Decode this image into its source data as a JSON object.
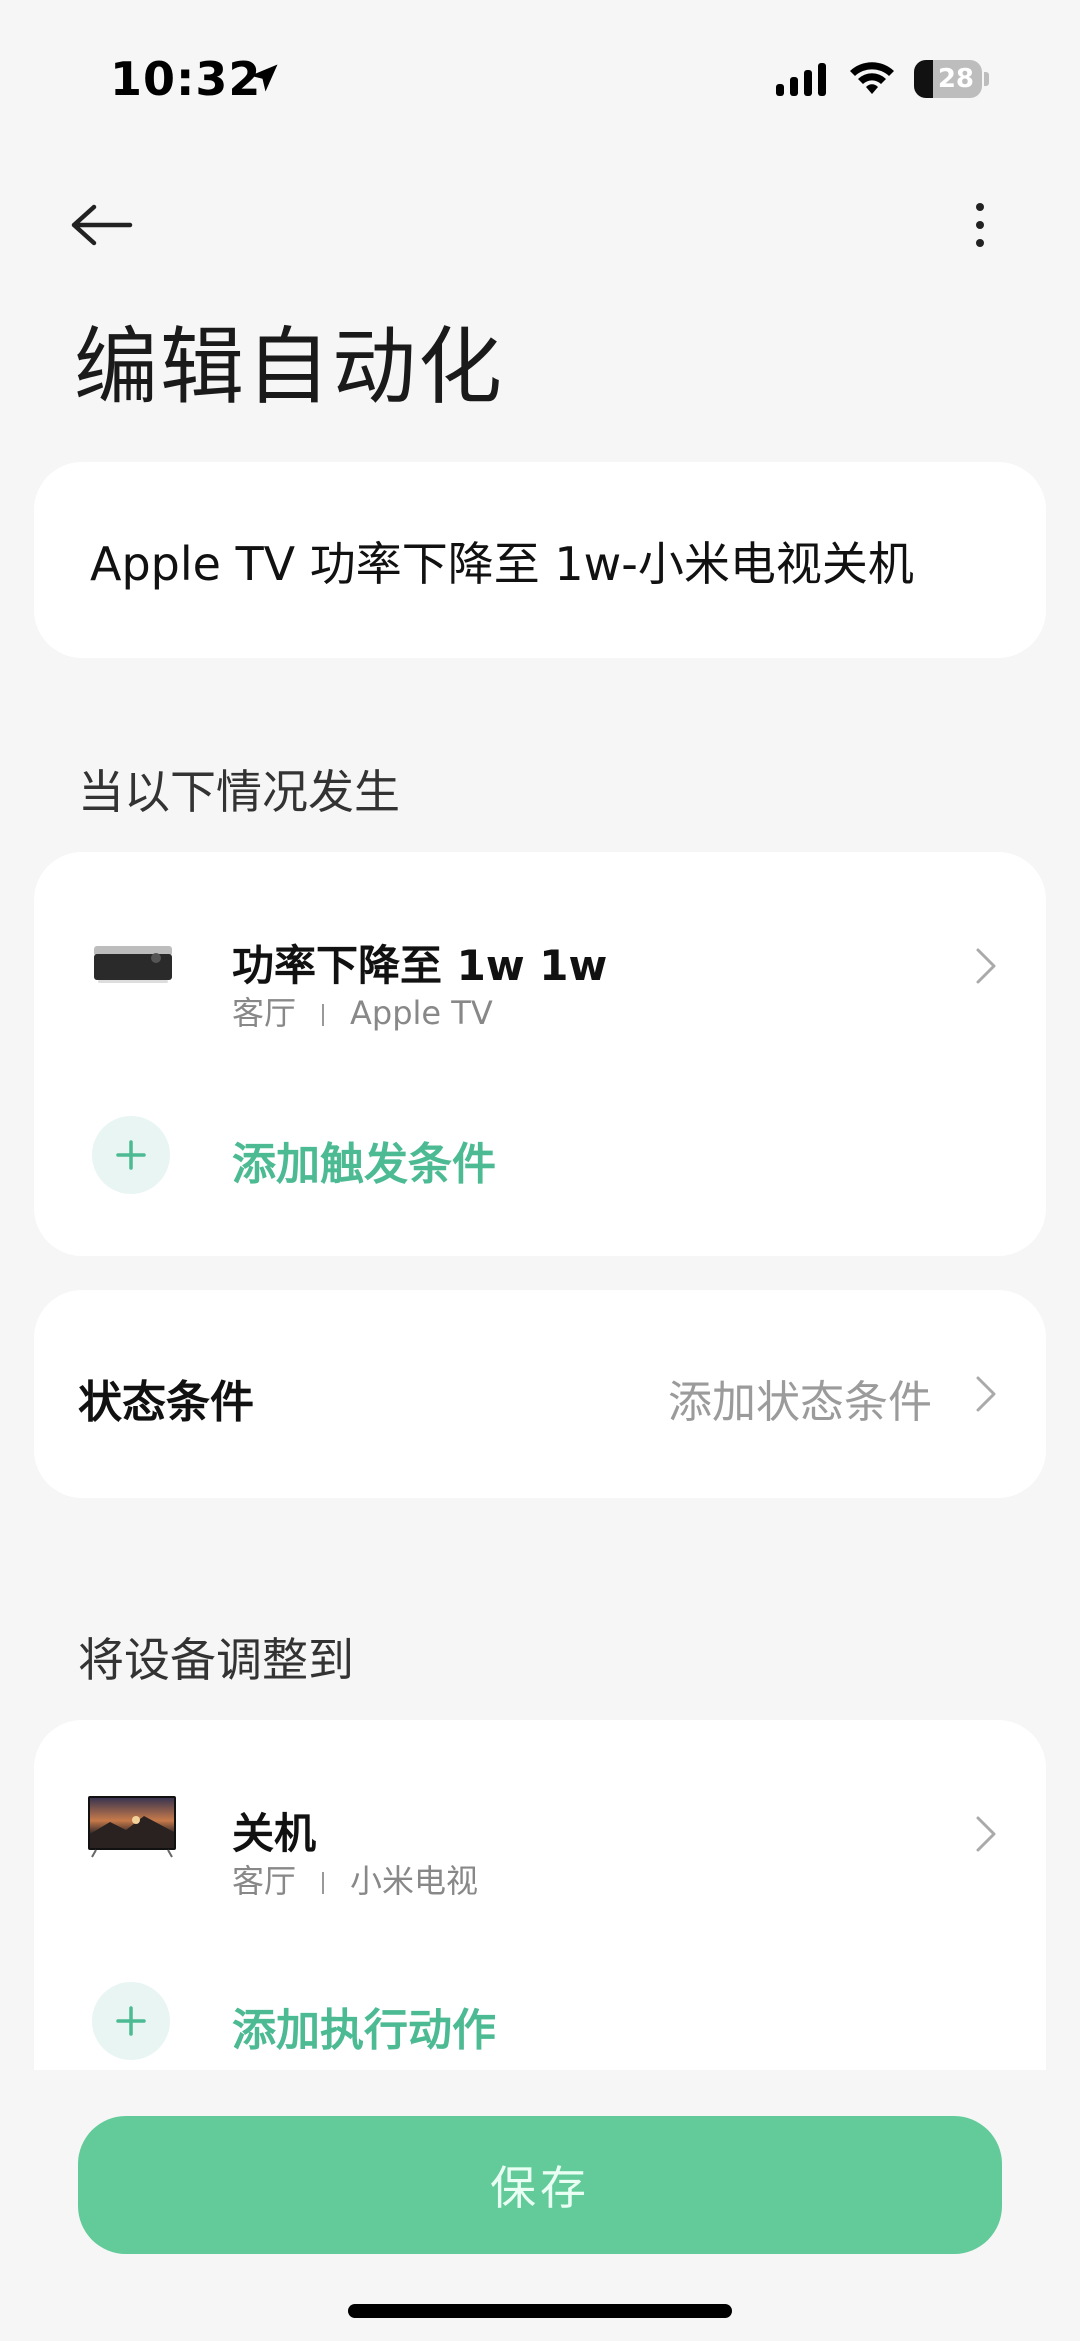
{
  "status_bar": {
    "time": "10:32",
    "battery_level": "28",
    "battery_fraction": 0.28
  },
  "header": {
    "title": "编辑自动化"
  },
  "automation": {
    "name": "Apple TV 功率下降至 1w-小米电视关机"
  },
  "trigger_section": {
    "label": "当以下情况发生",
    "items": [
      {
        "title": "功率下降至 1w 1w",
        "room": "客厅",
        "device": "Apple TV"
      }
    ],
    "add_label": "添加触发条件"
  },
  "state_conditions": {
    "label": "状态条件",
    "action_label": "添加状态条件"
  },
  "action_section": {
    "label": "将设备调整到",
    "items": [
      {
        "title": "关机",
        "room": "客厅",
        "device": "小米电视"
      }
    ],
    "add_label": "添加执行动作"
  },
  "footer": {
    "save_label": "保存"
  },
  "colors": {
    "accent": "#4cba92",
    "save_button": "#62cb99",
    "background": "#f6f6f6",
    "card": "#ffffff"
  },
  "icons": {
    "back": "arrow-left-icon",
    "more": "more-vertical-icon",
    "add": "plus-icon",
    "chevron": "chevron-right-icon",
    "location": "location-arrow-icon",
    "signal": "cellular-signal-icon",
    "wifi": "wifi-icon"
  }
}
